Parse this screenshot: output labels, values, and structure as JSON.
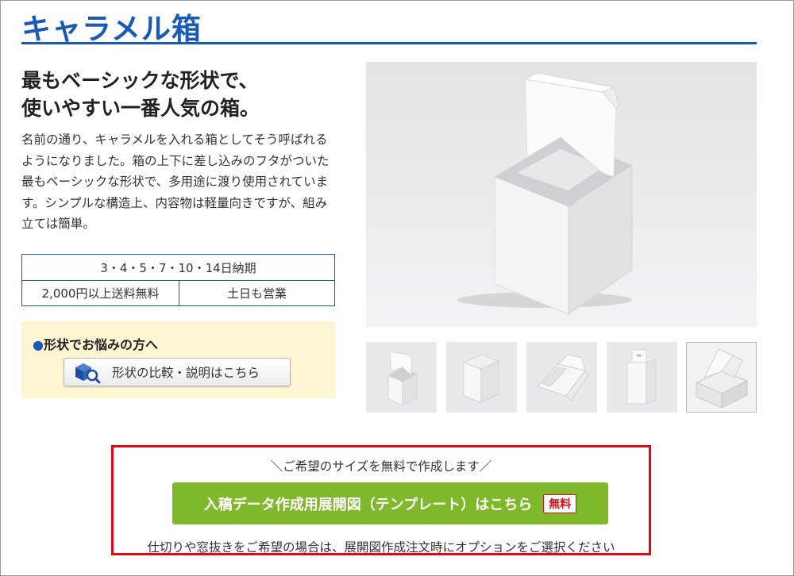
{
  "page": {
    "title": "キャラメル箱"
  },
  "intro": {
    "headline_line1": "最もベーシックな形状で、",
    "headline_line2": "使いやすい一番人気の箱。",
    "description": "名前の通り、キャラメルを入れる箱としてそう呼ばれるようになりました。箱の上下に差し込みのフタがついた最もベーシックな形状で、多用途に渡り使用されています。シンプルな構造上、内容物は軽量向きですが、組み立ては簡単。"
  },
  "info_table": {
    "delivery": "3・4・5・7・10・14日納期",
    "shipping": "2,000円以上送料無料",
    "weekend": "土日も営業"
  },
  "help": {
    "label": "形状でお悩みの方へ",
    "bullet": "●",
    "button_label": "形状の比較・説明はこちら",
    "button_icon": "box-search-icon"
  },
  "gallery": {
    "main_image": "open-caramel-box-photo",
    "thumbnails": [
      {
        "icon": "open-box-thumb"
      },
      {
        "icon": "closed-box-thumb"
      },
      {
        "icon": "flat-box-thumb"
      },
      {
        "icon": "hanger-box-thumb"
      },
      {
        "icon": "stacked-box-thumb"
      }
    ]
  },
  "cta": {
    "note": "＼ご希望のサイズを無料で作成します／",
    "button_label": "入稿データ作成用展開図（テンプレート）はこちら",
    "badge": "無料",
    "footer": "仕切りや窓抜きをご希望の場合は、展開図作成注文時にオプションをご選択ください",
    "button_color": "#80b82b",
    "border_color": "#e30617"
  },
  "colors": {
    "brand_blue": "#1a5ab5",
    "help_bg": "#fdf6d3"
  }
}
